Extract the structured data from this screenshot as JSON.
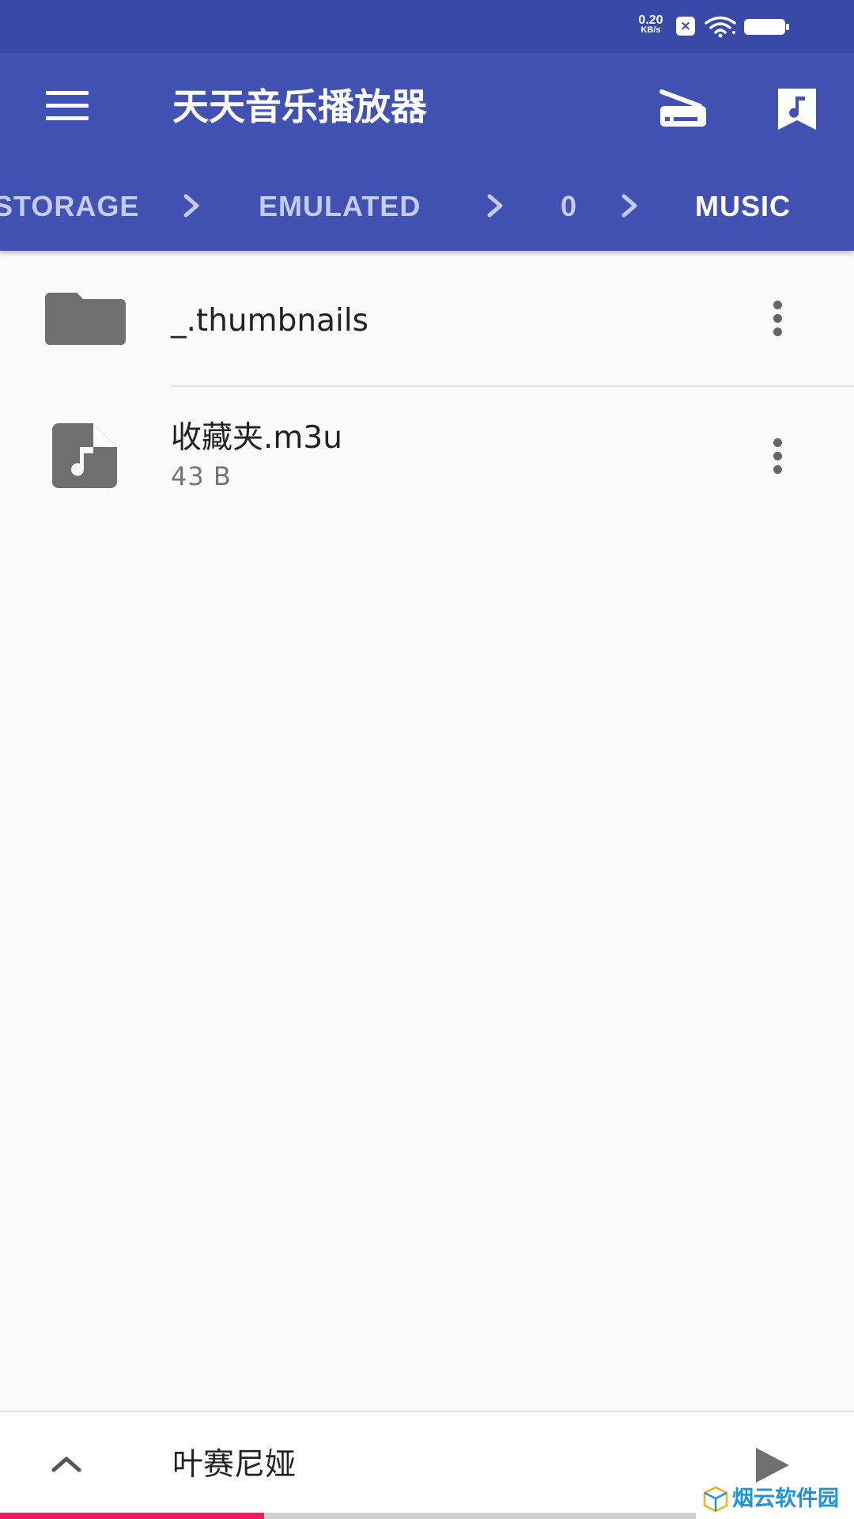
{
  "status_bar": {
    "net_speed_value": "0.20",
    "net_speed_unit": "KB/s",
    "notification_glyph": "×",
    "icons": [
      "notification-badge",
      "wifi-icon",
      "battery-icon"
    ]
  },
  "app_bar": {
    "title": "天天音乐播放器",
    "menu_icon": "hamburger-menu-icon",
    "actions": [
      "scanner-icon",
      "music-library-icon"
    ],
    "color": "#4152b3"
  },
  "breadcrumb": {
    "items": [
      "STORAGE",
      "EMULATED",
      "0",
      "MUSIC"
    ],
    "separator_icon": "chevron-right-icon",
    "current": "MUSIC"
  },
  "file_list": {
    "items": [
      {
        "name": "_.thumbnails",
        "type": "folder",
        "icon": "folder-icon",
        "size": ""
      },
      {
        "name": "收藏夹.m3u",
        "type": "file",
        "icon": "music-file-icon",
        "size": "43 B"
      }
    ]
  },
  "player": {
    "track_title": "叶赛尼娅",
    "expand_icon": "chevron-up-icon",
    "play_icon": "play-icon",
    "progress": 0.38,
    "accent_color": "#e91e63"
  },
  "watermark": {
    "text": "烟云软件园"
  }
}
